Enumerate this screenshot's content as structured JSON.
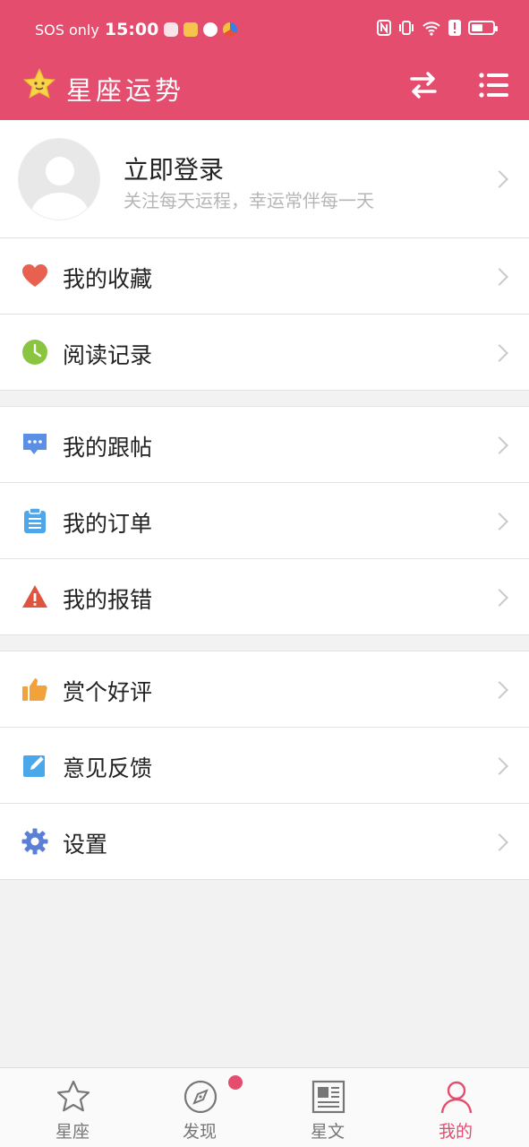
{
  "status_bar": {
    "carrier": "SOS only",
    "time": "15:00",
    "battery_level": 0.55
  },
  "app_bar": {
    "title": "星座运势",
    "icons": [
      "star-logo-icon",
      "swap-icon",
      "menu-list-icon"
    ]
  },
  "profile": {
    "title": "立即登录",
    "subtitle": "关注每天运程，幸运常伴每一天"
  },
  "groups": [
    {
      "items": [
        {
          "label": "我的收藏",
          "icon": "heart-icon"
        },
        {
          "label": "阅读记录",
          "icon": "clock-icon"
        }
      ]
    },
    {
      "items": [
        {
          "label": "我的跟帖",
          "icon": "comment-icon"
        },
        {
          "label": "我的订单",
          "icon": "clipboard-icon"
        },
        {
          "label": "我的报错",
          "icon": "warning-icon"
        }
      ]
    },
    {
      "items": [
        {
          "label": "赏个好评",
          "icon": "thumbs-up-icon"
        },
        {
          "label": "意见反馈",
          "icon": "edit-icon"
        },
        {
          "label": "设置",
          "icon": "gear-icon"
        }
      ]
    }
  ],
  "bottom_nav": [
    {
      "label": "星座",
      "icon": "star-outline-icon"
    },
    {
      "label": "发现",
      "icon": "compass-icon"
    },
    {
      "label": "星文",
      "icon": "newspaper-icon"
    },
    {
      "label": "我的",
      "icon": "person-icon"
    }
  ],
  "colors": {
    "primary": "#e44d6e",
    "heart": "#e8604f",
    "clock": "#8ac53f",
    "comment": "#5b8fe6",
    "clipboard": "#4fa6e8",
    "warning": "#e0533e",
    "thumbs": "#f1a23a",
    "edit": "#4aa8ea",
    "gear": "#5b7fd6"
  }
}
